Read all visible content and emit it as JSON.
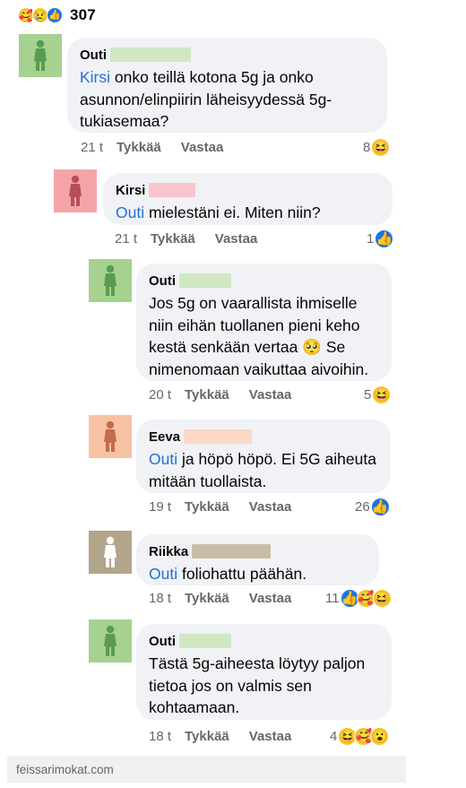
{
  "post": {
    "reaction_icons": [
      "care-emoji",
      "sad-emoji",
      "like-emoji"
    ],
    "reaction_count": "307"
  },
  "comments": [
    {
      "author": "Outi",
      "avatar_color": "#a6d18f",
      "figure_color": "#5a9b52",
      "redaction_color": "#cfe8c3",
      "mention": "Kirsi",
      "text": " onko teillä kotona 5g ja onko asunnon/elinpiirin läheisyydessä 5g-tukiasemaa?",
      "time": "21 t",
      "like_label": "Tykkää",
      "reply_label": "Vastaa",
      "reaction_count": "8",
      "reactions": [
        "haha-emoji"
      ]
    },
    {
      "author": "Kirsi",
      "avatar_color": "#f4a4a9",
      "figure_color": "#b84e55",
      "redaction_color": "#f8c6ca",
      "mention": "Outi",
      "text": " mielestäni ei. Miten niin?",
      "time": "21 t",
      "like_label": "Tykkää",
      "reply_label": "Vastaa",
      "reaction_count": "1",
      "reactions": [
        "like-emoji"
      ]
    },
    {
      "author": "Outi",
      "avatar_color": "#a6d18f",
      "figure_color": "#5a9b52",
      "redaction_color": "#cfe8c3",
      "mention": "",
      "text": "Jos 5g on vaarallista ihmiselle niin eihän tuollanen pieni keho kestä senkään vertaa 🥺 Se nimenomaan vaikuttaa aivoihin.",
      "time": "20 t",
      "like_label": "Tykkää",
      "reply_label": "Vastaa",
      "reaction_count": "5",
      "reactions": [
        "haha-emoji"
      ]
    },
    {
      "author": "Eeva",
      "avatar_color": "#f7c2a4",
      "figure_color": "#c46c4c",
      "redaction_color": "#fbd9c4",
      "mention": "Outi",
      "text": " ja höpö höpö. Ei 5G aiheuta mitään tuollaista.",
      "time": "19 t",
      "like_label": "Tykkää",
      "reply_label": "Vastaa",
      "reaction_count": "26",
      "reactions": [
        "like-emoji"
      ]
    },
    {
      "author": "Riikka",
      "avatar_color": "#b2a58a",
      "figure_color": "#ffffff",
      "redaction_color": "#c8bea7",
      "mention": "Outi",
      "text": " foliohattu päähän.",
      "time": "18 t",
      "like_label": "Tykkää",
      "reply_label": "Vastaa",
      "reaction_count": "11",
      "reactions": [
        "like-emoji",
        "care-emoji",
        "haha-emoji"
      ]
    },
    {
      "author": "Outi",
      "avatar_color": "#a6d18f",
      "figure_color": "#5a9b52",
      "redaction_color": "#cfe8c3",
      "mention": "",
      "text": "Tästä 5g-aiheesta löytyy paljon tietoa jos on valmis sen kohtaamaan.",
      "time": "18 t",
      "like_label": "Tykkää",
      "reply_label": "Vastaa",
      "reaction_count": "4",
      "reactions": [
        "haha-emoji",
        "care-emoji",
        "wow-emoji"
      ]
    }
  ],
  "footer": {
    "watermark": "feissarimokat.com"
  }
}
